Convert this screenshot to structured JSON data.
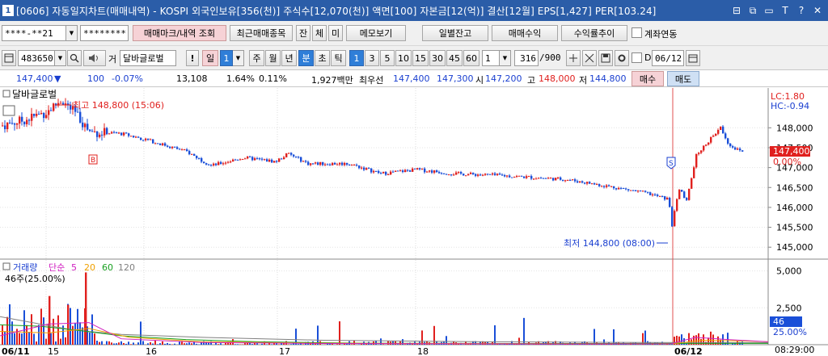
{
  "window": {
    "number": "1",
    "title": "[0606] 자동일지차트(매매내역) - KOSPI 외국인보유[356(천)] 주식수[12,070(천)] 액면[100] 자본금[12(억)] 결산[12월] EPS[1,427] PER[103.24]",
    "buttons": [
      "⊟",
      "⧉",
      "▭",
      "T",
      "?",
      "✕"
    ]
  },
  "toolbar1": {
    "account_value": "****-**21",
    "password_value": "********",
    "trade_mark_btn": "매매마크/내역 조회",
    "recent_btn": "최근매매종목",
    "small_btns": [
      "잔",
      "체",
      "미"
    ],
    "memo_btn": "메모보기",
    "daily_balance_btn": "일별잔고",
    "trade_profit_btn": "매매수익",
    "return_btn": "수익률추이",
    "account_link_label": "계좌연동"
  },
  "toolbar2": {
    "code_value": "483650",
    "prefix": "거",
    "stock_name": "달바글로벌",
    "excl": "!",
    "period_label": "일",
    "period_value": "1",
    "period_btns": [
      "주",
      "월",
      "년",
      "분",
      "초",
      "틱"
    ],
    "active_period": "분",
    "interval_btns": [
      "1",
      "3",
      "5",
      "10",
      "15",
      "30",
      "45",
      "60"
    ],
    "active_interval": "1",
    "interval_value": "1",
    "count_value": "316",
    "count_total": "/900",
    "d_label": "D",
    "date_value": "06/12"
  },
  "quote": {
    "price": "147,400",
    "change_arrow": "▼",
    "change": "100",
    "change_pct": "-0.07%",
    "volume": "13,108",
    "vol_ratio": "1.64%",
    "turnover": "0.11%",
    "amount": "1,927백만",
    "best_label": "최우선",
    "best_ask": "147,400",
    "best_bid": "147,300",
    "open_label": "시",
    "open": "147,200",
    "high_label": "고",
    "high": "148,000",
    "low_label": "저",
    "low": "144,800",
    "buy_btn": "매수",
    "sell_btn": "매도"
  },
  "chart_meta": {
    "stock_label": "달바글로벌",
    "high_annotation": "최고 148,800 (15:06)",
    "low_annotation": "최저 144,800 (08:00)",
    "lc": "LC:1.80",
    "hc": "HC:-0.94",
    "current_price_tag": "147,400",
    "current_pct_tag": "0.00%",
    "buy_marker": "B",
    "sell_marker": "S",
    "volume_legend": {
      "title": "거래량",
      "ma_label": "단순",
      "ma_values": [
        "5",
        "20",
        "60",
        "120"
      ],
      "sub": "46주(25.00%)"
    },
    "volume_tag": "46",
    "volume_pct_tag": "25.00%",
    "clock": "08:29:00",
    "colors": {
      "up": "#e0201e",
      "down": "#1a4fd8",
      "ma5": "#d020c0",
      "ma20": "#f0a000",
      "ma60": "#18a020",
      "ma120": "#808080",
      "day_divider": "#e05050"
    }
  },
  "chart_data": {
    "type": "candlestick",
    "price_axis": {
      "ticks": [
        "148,000",
        "147,500",
        "147,000",
        "146,500",
        "146,000",
        "145,500",
        "145,000"
      ],
      "range": [
        144700,
        149000
      ]
    },
    "volume_axis": {
      "ticks": [
        "5,000",
        "2,500"
      ],
      "range": [
        0,
        5800
      ]
    },
    "date_labels": [
      "06/11",
      "15",
      "16",
      "17",
      "18",
      "06/12"
    ]
  }
}
